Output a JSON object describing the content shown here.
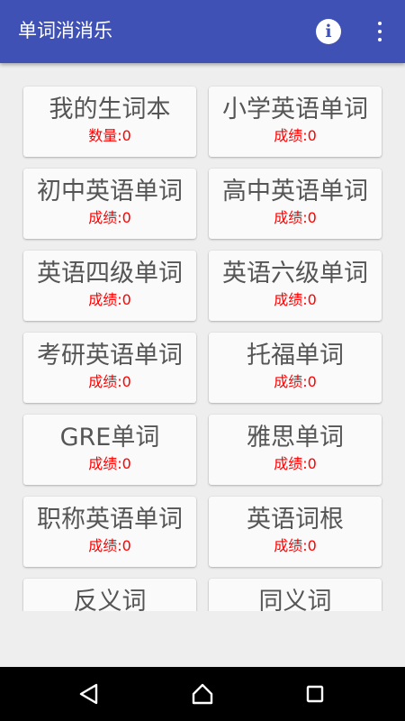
{
  "app": {
    "title": "单词消消乐"
  },
  "toolbar": {
    "info_icon": "info-icon",
    "more_icon": "more-vert-icon",
    "info_glyph": "i"
  },
  "colors": {
    "primary": "#3f51b5",
    "score": "#ff0000",
    "background": "#eeeeee",
    "card": "#fafafa"
  },
  "cards": [
    {
      "name": "我的生词本",
      "score": "数量:0"
    },
    {
      "name": "小学英语单词",
      "score": "成绩:0"
    },
    {
      "name": "初中英语单词",
      "score": "成绩:0"
    },
    {
      "name": "高中英语单词",
      "score": "成绩:0"
    },
    {
      "name": "英语四级单词",
      "score": "成绩:0"
    },
    {
      "name": "英语六级单词",
      "score": "成绩:0"
    },
    {
      "name": "考研英语单词",
      "score": "成绩:0"
    },
    {
      "name": "托福单词",
      "score": "成绩:0"
    },
    {
      "name": "GRE单词",
      "score": "成绩:0"
    },
    {
      "name": "雅思单词",
      "score": "成绩:0"
    },
    {
      "name": "职称英语单词",
      "score": "成绩:0"
    },
    {
      "name": "英语词根",
      "score": "成绩:0"
    },
    {
      "name": "反义词",
      "score": ""
    },
    {
      "name": "同义词",
      "score": ""
    }
  ],
  "navbar": {
    "back_icon": "back-triangle-icon",
    "home_icon": "home-icon",
    "recents_icon": "recents-square-icon"
  }
}
